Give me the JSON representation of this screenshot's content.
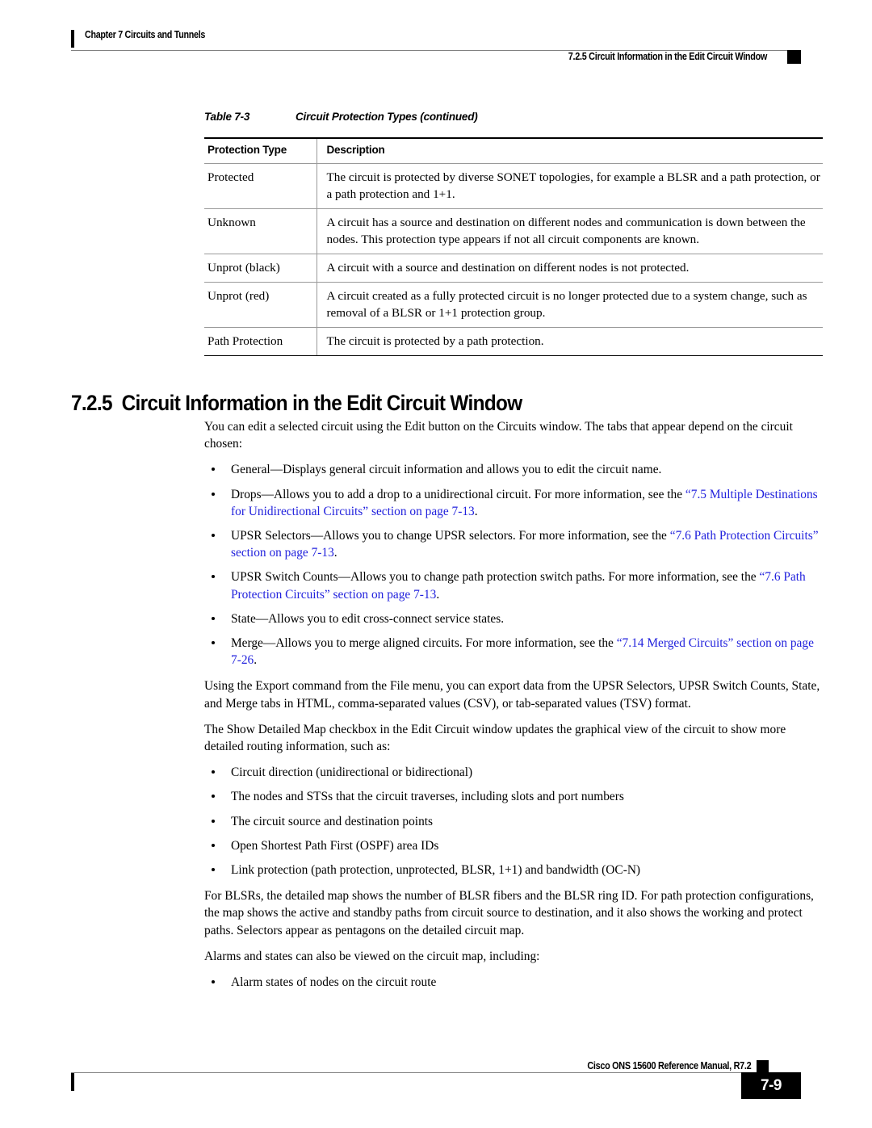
{
  "header": {
    "chapter": "Chapter 7 Circuits and Tunnels",
    "section": "7.2.5  Circuit Information in the Edit Circuit Window"
  },
  "table": {
    "caption_number": "Table 7-3",
    "caption_title": "Circuit Protection Types (continued)",
    "columns": [
      "Protection Type",
      "Description"
    ],
    "rows": [
      {
        "type": "Protected",
        "description": "The circuit is protected by diverse SONET topologies, for example a BLSR and a path protection, or a path protection and 1+1."
      },
      {
        "type": "Unknown",
        "description": "A circuit has a source and destination on different nodes and communication is down between the nodes. This protection type appears if not all circuit components are known."
      },
      {
        "type": "Unprot (black)",
        "description": "A circuit with a source and destination on different nodes is not protected."
      },
      {
        "type": "Unprot (red)",
        "description": "A circuit created as a fully protected circuit is no longer protected due to a system change, such as removal of a BLSR or 1+1 protection group."
      },
      {
        "type": "Path Protection",
        "description": "The circuit is protected by a path protection."
      }
    ]
  },
  "section": {
    "number": "7.2.5",
    "title": "Circuit Information in the Edit Circuit Window"
  },
  "body": {
    "intro": "You can edit a selected circuit using the Edit button on the Circuits window. The tabs that appear depend on the circuit chosen:",
    "tabs": {
      "general": "General—Displays general circuit information and allows you to edit the circuit name.",
      "drops_pre": "Drops—Allows you to add a drop to a unidirectional circuit. For more information, see the ",
      "drops_link": "“7.5  Multiple Destinations for Unidirectional Circuits” section on page 7-13",
      "drops_post": ".",
      "upsr_selectors_pre": "UPSR Selectors—Allows you to change UPSR selectors. For more information, see the ",
      "upsr_selectors_link": "“7.6  Path Protection Circuits” section on page 7-13",
      "upsr_selectors_post": ".",
      "upsr_switch_pre": "UPSR Switch Counts—Allows you to change path protection switch paths. For more information, see the ",
      "upsr_switch_link": "“7.6  Path Protection Circuits” section on page 7-13",
      "upsr_switch_post": ".",
      "state": "State—Allows you to edit cross-connect service states.",
      "merge_pre": "Merge—Allows you to merge aligned circuits. For more information, see the ",
      "merge_link": "“7.14  Merged Circuits” section on page 7-26",
      "merge_post": "."
    },
    "export_paragraph": "Using the Export command from the File menu, you can export data from the UPSR Selectors, UPSR Switch Counts, State, and Merge tabs in HTML, comma-separated values (CSV), or tab-separated values (TSV) format.",
    "detailed_map_paragraph": "The Show Detailed Map checkbox in the Edit Circuit window updates the graphical view of the circuit to show more detailed routing information, such as:",
    "detailed_map_items": [
      "Circuit direction (unidirectional or bidirectional)",
      "The nodes and STSs that the circuit traverses, including slots and port numbers",
      "The circuit source and destination points",
      "Open Shortest Path First (OSPF) area IDs",
      "Link protection (path protection, unprotected, BLSR, 1+1) and bandwidth (OC-N)"
    ],
    "blsr_paragraph": "For BLSRs, the detailed map shows the number of BLSR fibers and the BLSR ring ID. For path protection configurations, the map shows the active and standby paths from circuit source to destination, and it also shows the working and protect paths. Selectors appear as pentagons on the detailed circuit map.",
    "alarms_paragraph": "Alarms and states can also be viewed on the circuit map, including:",
    "alarms_items": [
      "Alarm states of nodes on the circuit route"
    ]
  },
  "footer": {
    "manual": "Cisco ONS 15600 Reference Manual, R7.2",
    "page_number": "7-9"
  },
  "colors": {
    "link": "#2222DD",
    "rule": "#808080",
    "table_rule": "#9A9A9A",
    "text": "#000000"
  }
}
